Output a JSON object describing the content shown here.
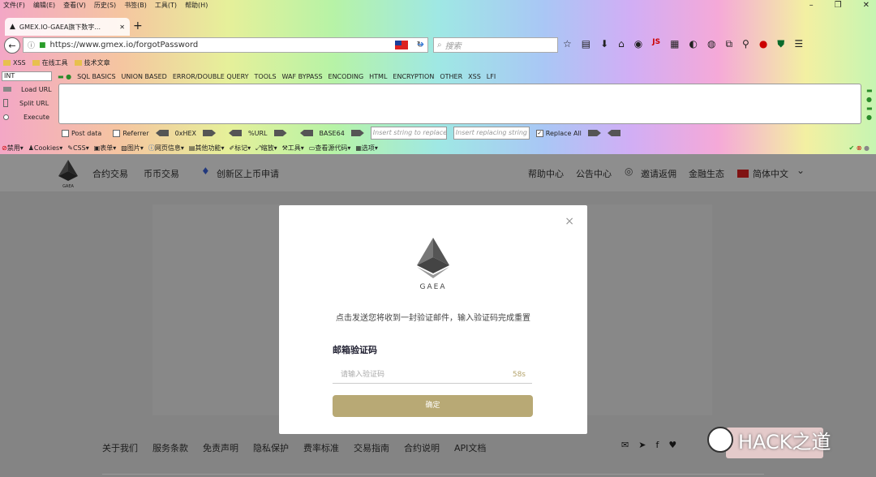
{
  "menubar": {
    "items": [
      "文件(F)",
      "编辑(E)",
      "查看(V)",
      "历史(S)",
      "书签(B)",
      "工具(T)",
      "帮助(H)"
    ]
  },
  "tab": {
    "title": "GMEX.IO-GAEA旗下数字...",
    "close": "✕",
    "new": "+"
  },
  "window_controls": [
    "–",
    "❐",
    "✕"
  ],
  "url": "https://www.gmex.io/forgotPassword",
  "search_placeholder": "搜索",
  "bookmarks": [
    "XSS",
    "在线工具",
    "技术文章"
  ],
  "hackbar": {
    "select_value": "INT",
    "menus": [
      "SQL BASICS",
      "UNION BASED",
      "ERROR/DOUBLE QUERY",
      "TOOLS",
      "WAF BYPASS",
      "ENCODING",
      "HTML",
      "ENCRYPTION",
      "OTHER",
      "XSS",
      "LFI"
    ],
    "load_url": "Load URL",
    "split_url": "Split URL",
    "execute": "Execute",
    "post_data": "Post data",
    "referrer": "Referrer",
    "hex": "0xHEX",
    "url_enc": "%URL",
    "base64": "BASE64",
    "insert_placeholder": "Insert string to replace",
    "replacing_placeholder": "Insert replacing string",
    "replace_all": "Replace All"
  },
  "webdev": [
    "禁用",
    "Cookies",
    "CSS",
    "表单",
    "图片",
    "网页信息",
    "其他功能",
    "标记",
    "缩放",
    "工具",
    "查看源代码",
    "选项"
  ],
  "site": {
    "logo_text": "GAEA",
    "nav_left": [
      "合约交易",
      "币币交易",
      "创新区上币申请"
    ],
    "nav_right": [
      "帮助中心",
      "公告中心",
      "邀请返佣",
      "金融生态",
      "简体中文"
    ]
  },
  "modal": {
    "close": "×",
    "logo_text": "GAEA",
    "description": "点击发送您将收到一封验证邮件，输入验证码完成重置",
    "label": "邮箱验证码",
    "placeholder": "请输入验证码",
    "countdown": "58s",
    "confirm": "确定"
  },
  "footer": {
    "links": [
      "关于我们",
      "服务条款",
      "免责声明",
      "隐私保护",
      "费率标准",
      "交易指南",
      "合约说明",
      "API文档"
    ]
  },
  "watermark": "HACK之道",
  "colors": {
    "accent": "#b8a975",
    "modal_bg": "#ffffff",
    "overlay": "rgba(0,0,0,0.42)"
  }
}
